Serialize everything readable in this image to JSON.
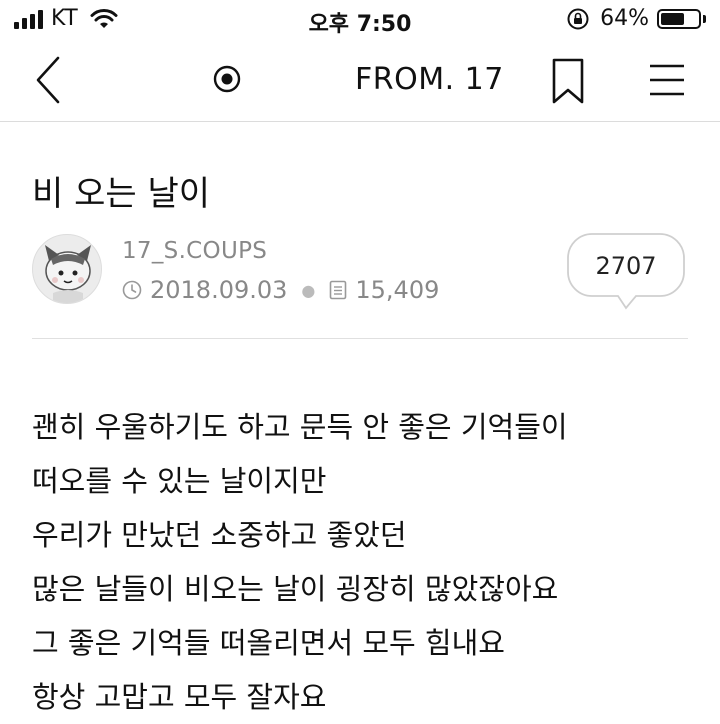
{
  "status_bar": {
    "carrier": "KT",
    "time": "오후 7:50",
    "battery_text": "64%",
    "battery_level": 0.64,
    "icons": [
      "signal-icon",
      "wifi-icon",
      "orientation-lock-icon",
      "battery-icon"
    ]
  },
  "nav": {
    "title": "FROM. 17",
    "icons": [
      "back-chevron-icon",
      "radio-target-icon",
      "bookmark-icon",
      "hamburger-menu-icon"
    ]
  },
  "post": {
    "title": "비 오는 날이",
    "author": "17_S.COUPS",
    "date": "2018.09.03",
    "views": "15,409",
    "comment_count": "2707",
    "lines": [
      "괜히 우울하기도 하고 문득 안 좋은 기억들이",
      "떠오를 수 있는 날이지만",
      "우리가 만났던 소중하고 좋았던",
      "많은 날들이 비오는 날이 굉장히 많았잖아요",
      "그 좋은 기억들 떠올리면서 모두 힘내요",
      "항상 고맙고 모두 잘자요"
    ]
  },
  "colors": {
    "text": "#111111",
    "muted": "#888888",
    "divider": "#e0e0e0"
  }
}
